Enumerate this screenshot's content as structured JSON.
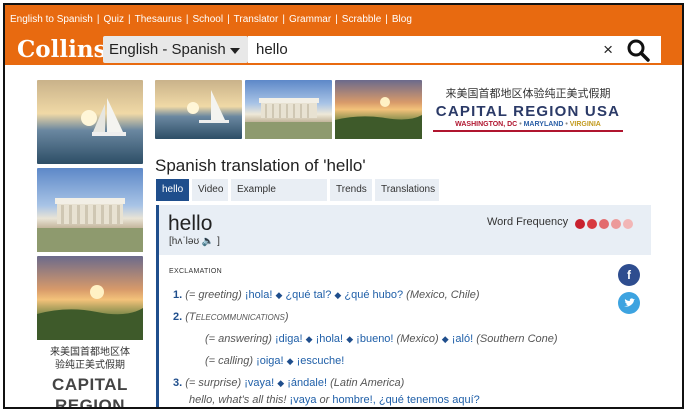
{
  "header": {
    "links": [
      "English to Spanish",
      "Quiz",
      "Thesaurus",
      "School",
      "Translator",
      "Grammar",
      "Scrabble",
      "Blog"
    ],
    "logo": "Collins",
    "language_select": "English - Spanish",
    "search_value": "hello",
    "clear_icon": "×"
  },
  "ads": {
    "banner_zh": "来美国首都地区体验纯正美式假期",
    "banner_title": "CAPITAL REGION USA",
    "banner_sub_1": "WASHINGTON, DC",
    "banner_sub_2": "MARYLAND",
    "banner_sub_3": "VIRGINIA",
    "side_zh_1": "来美国首都地区体",
    "side_zh_2": "验纯正美式假期",
    "side_big_1": "CAPITAL",
    "side_big_2": "REGION"
  },
  "page": {
    "heading": "Spanish translation of 'hello'",
    "tabs": [
      "hello",
      "Video",
      "Example sentences",
      "Trends",
      "Translations"
    ]
  },
  "entry": {
    "word": "hello",
    "pronunciation": "[hʌˈləʊ",
    "pronunciation_end": "]",
    "word_frequency_label": "Word Frequency",
    "pos": "EXCLAMATION",
    "senses": {
      "s1_num": "1.",
      "s1_ctx": "(= greeting)",
      "s1_t1": "¡hola!",
      "s1_t2": "¿qué tal?",
      "s1_t3": "¿qué hubo?",
      "s1_region": "(Mexico, Chile)",
      "s2_num": "2.",
      "s2_ctx": "(Telecommunications)",
      "s2a_ctx": "(= answering)",
      "s2a_t1": "¡diga!",
      "s2a_t2": "¡hola!",
      "s2a_t3": "¡bueno!",
      "s2a_r1": "(Mexico)",
      "s2a_t4": "¡aló!",
      "s2a_r2": "(Southern Cone)",
      "s2b_ctx": "(= calling)",
      "s2b_t1": "¡oiga!",
      "s2b_t2": "¡escuche!",
      "s3_num": "3.",
      "s3_ctx": "(= surprise)",
      "s3_t1": "¡vaya!",
      "s3_t2": "¡ándale!",
      "s3_region": "(Latin America)",
      "s3_ex": "hello, what's all this!",
      "s3_ex_t1": "¡vaya",
      "s3_or": "or",
      "s3_ex_t2": "hombre!,",
      "s3_ex_t3": "¿qué tenemos aquí?"
    }
  },
  "colors": {
    "brand_orange": "#e86a10",
    "accent_blue": "#1f4e8c"
  }
}
